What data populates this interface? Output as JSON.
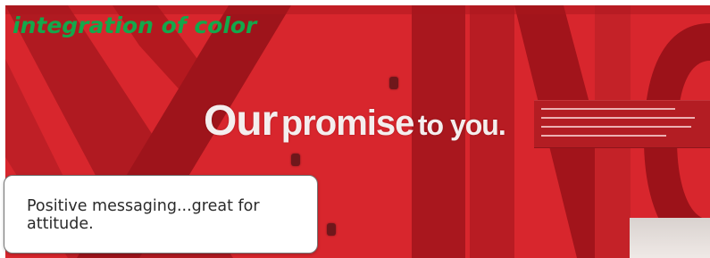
{
  "caption": "integration of color",
  "wall": {
    "headline_part1": "Our",
    "headline_part2": "promise",
    "headline_part3": "to you.",
    "base_color": "#d8262d",
    "stripe_color": "#a8161d",
    "light_stripe_color": "#e53a3a"
  },
  "note": {
    "text": "Positive messaging...great for attitude."
  },
  "colors": {
    "caption": "#13a84b",
    "headline": "#f4eeee",
    "panel": "#b31d23"
  }
}
